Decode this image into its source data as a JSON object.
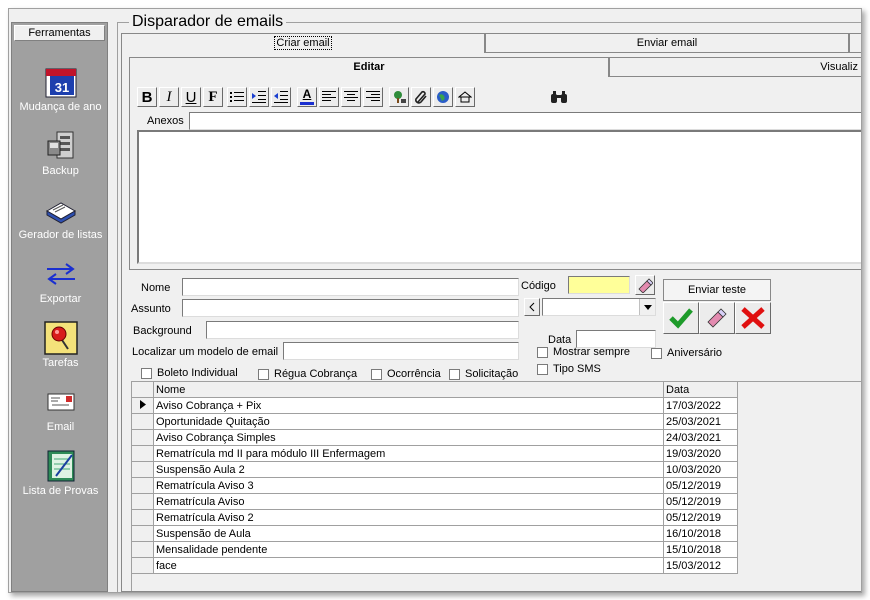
{
  "app": {
    "title": "Disparador de emails"
  },
  "sidebar": {
    "header": "Ferramentas",
    "items": [
      {
        "label": "Mudança de ano",
        "icon": "calendar-icon"
      },
      {
        "label": "Backup",
        "icon": "backup-icon"
      },
      {
        "label": "Gerador de listas",
        "icon": "book-icon"
      },
      {
        "label": "Exportar",
        "icon": "export-arrows-icon"
      },
      {
        "label": "Tarefas",
        "icon": "pushpin-icon"
      },
      {
        "label": "Email",
        "icon": "envelope-icon"
      },
      {
        "label": "Lista de Provas",
        "icon": "notebook-icon"
      }
    ]
  },
  "tabs": [
    {
      "label": "Criar email",
      "active": true
    },
    {
      "label": "Enviar email",
      "active": false
    }
  ],
  "subtabs": [
    {
      "label": "Editar",
      "active": true
    },
    {
      "label": "Visualiz",
      "active": false
    }
  ],
  "editor": {
    "attachments_label": "Anexos"
  },
  "toolbar": {
    "bold": "B",
    "italic": "I",
    "underline": "U",
    "font": "F",
    "font_color": "A"
  },
  "form": {
    "name_label": "Nome",
    "subject_label": "Assunto",
    "background_label": "Background",
    "search_model_label": "Localizar um modelo de email",
    "code_label": "Código",
    "date_label": "Data",
    "send_test_label": "Enviar teste",
    "always_show_label": "Mostrar sempre",
    "birthday_label": "Aniversário",
    "sms_type_label": "Tipo SMS",
    "code_color": "#ffff99"
  },
  "filters": [
    {
      "label": "Boleto Individual"
    },
    {
      "label": "Régua Cobrança"
    },
    {
      "label": "Ocorrência"
    },
    {
      "label": "Solicitação"
    }
  ],
  "table": {
    "columns": [
      "Nome",
      "Data"
    ],
    "rows": [
      {
        "name": "Aviso Cobrança + Pix",
        "date": "17/03/2022",
        "current": true
      },
      {
        "name": "Oportunidade Quitação",
        "date": "25/03/2021"
      },
      {
        "name": "Aviso Cobrança Simples",
        "date": "24/03/2021"
      },
      {
        "name": "Rematrícula md II para módulo III Enfermagem",
        "date": "19/03/2020"
      },
      {
        "name": "Suspensão Aula 2",
        "date": "10/03/2020"
      },
      {
        "name": "Rematrícula Aviso 3",
        "date": "05/12/2019"
      },
      {
        "name": "Rematrícula Aviso",
        "date": "05/12/2019"
      },
      {
        "name": "Rematrícula Aviso 2",
        "date": "05/12/2019"
      },
      {
        "name": "Suspensão de Aula",
        "date": "16/10/2018"
      },
      {
        "name": "Mensalidade pendente",
        "date": "15/10/2018"
      },
      {
        "name": "face",
        "date": "15/03/2012"
      }
    ]
  }
}
